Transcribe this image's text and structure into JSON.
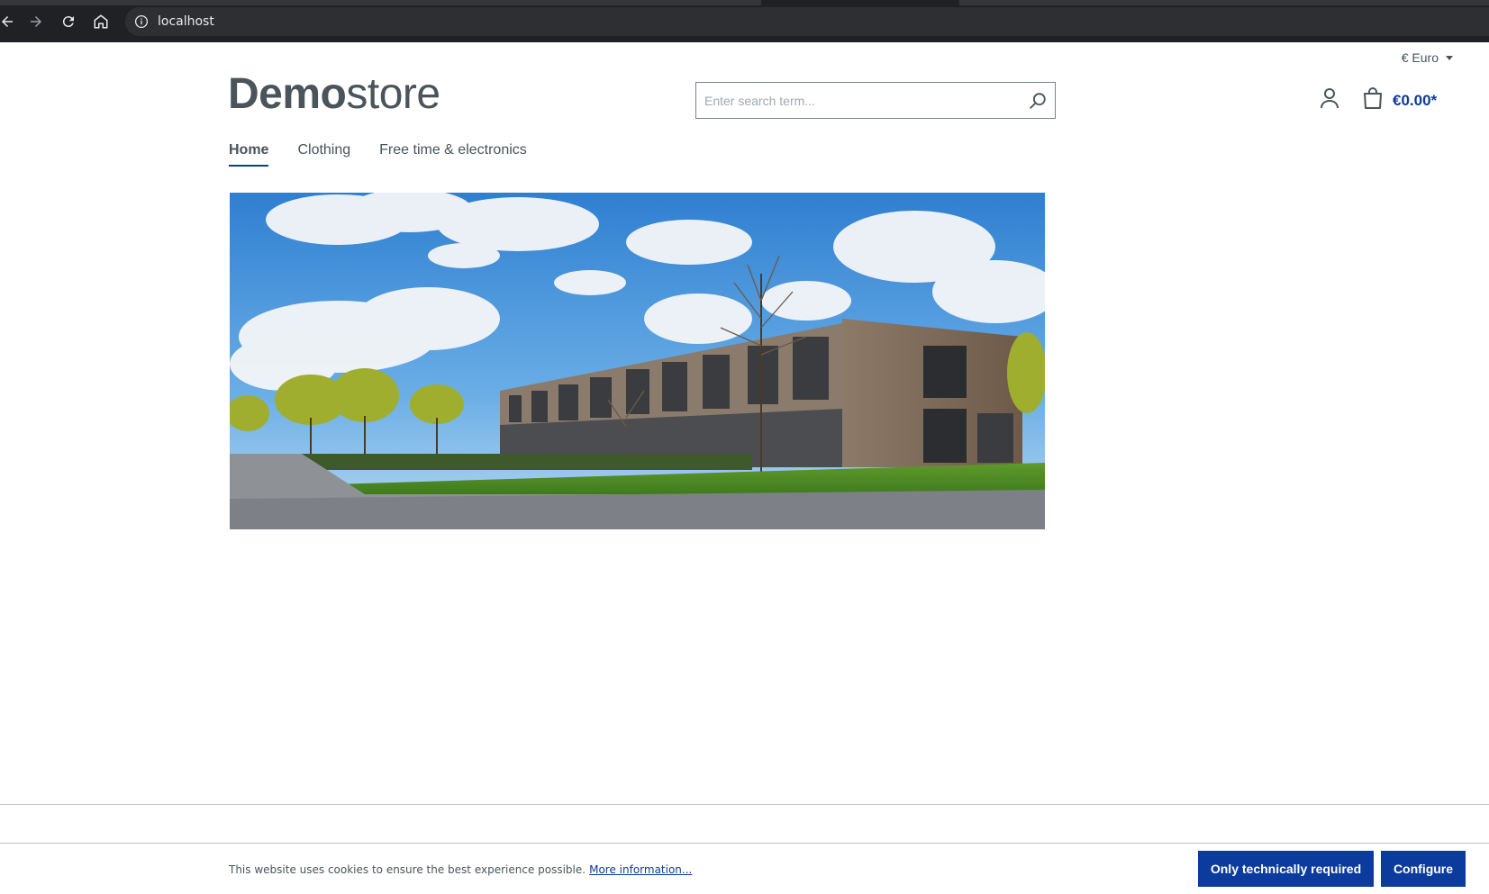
{
  "browser": {
    "url": "localhost"
  },
  "header": {
    "currency": "€ Euro",
    "logo_bold": "Demo",
    "logo_light": "store",
    "search_placeholder": "Enter search term...",
    "cart_total": "€0.00*"
  },
  "nav": {
    "items": [
      {
        "label": "Home",
        "active": true
      },
      {
        "label": "Clothing",
        "active": false
      },
      {
        "label": "Free time & electronics",
        "active": false
      }
    ]
  },
  "cookie": {
    "text": "This website uses cookies to ensure the best experience possible.",
    "link": "More information...",
    "btn_technical": "Only technically required",
    "btn_configure": "Configure"
  },
  "colors": {
    "brand": "#0b3b9c",
    "text": "#4a545b"
  }
}
